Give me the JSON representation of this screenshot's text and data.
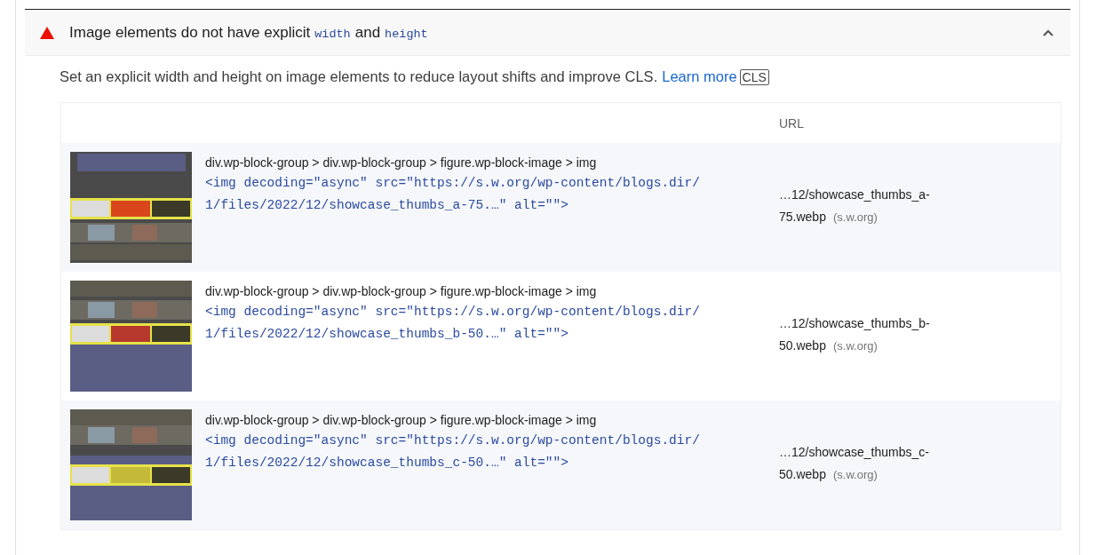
{
  "audit": {
    "failed": true,
    "expanded": true,
    "title": [
      {
        "kind": "text",
        "text": "Image elements do not have explicit"
      },
      {
        "kind": "code",
        "text": "width"
      },
      {
        "kind": "text",
        "text": "and"
      },
      {
        "kind": "code",
        "text": "height"
      }
    ],
    "description": [
      {
        "kind": "text",
        "text": "Set an explicit width and height on image elements to reduce layout shifts and improve CLS."
      },
      {
        "kind": "link",
        "text": "Learn more"
      },
      {
        "kind": "tag",
        "text": "CLS"
      }
    ]
  },
  "table": {
    "columns": [
      {
        "label": "URL"
      }
    ],
    "rows": [
      {
        "selector": "div.wp-block-group > div.wp-block-group > figure.wp-block-image > img",
        "snippet": "<img decoding=\"async\" src=\"https://s.w.org/wp-content/blogs.dir/1/files/2022/12/showcase_thumbs_a-75.…\" alt=\"\">",
        "url": "…12/showcase_thumbs_a-75.webp",
        "host": "(s.w.org)"
      },
      {
        "selector": "div.wp-block-group > div.wp-block-group > figure.wp-block-image > img",
        "snippet": "<img decoding=\"async\" src=\"https://s.w.org/wp-content/blogs.dir/1/files/2022/12/showcase_thumbs_b-50.…\" alt=\"\">",
        "url": "…12/showcase_thumbs_b-50.webp",
        "host": "(s.w.org)"
      },
      {
        "selector": "div.wp-block-group > div.wp-block-group > figure.wp-block-image > img",
        "snippet": "<img decoding=\"async\" src=\"https://s.w.org/wp-content/blogs.dir/1/files/2022/12/showcase_thumbs_c-50.…\" alt=\"\">",
        "url": "…12/showcase_thumbs_c-50.webp",
        "host": "(s.w.org)"
      }
    ]
  }
}
